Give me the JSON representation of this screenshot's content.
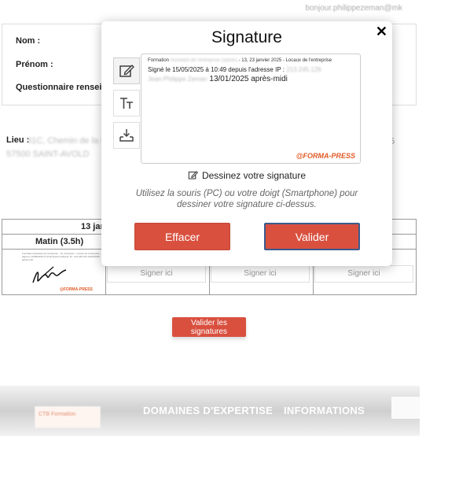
{
  "header": {
    "user_email": "bonjour.philippezeman@mk"
  },
  "info": {
    "nom_label": "Nom :",
    "prenom_label": "Prénom :",
    "questionnaire_label": "Questionnaire renseigné le"
  },
  "location": {
    "label": "Lieu :",
    "value_line1": "31C, Chemin de la Cascade",
    "value_line2": "57500 SAINT-AVOLD",
    "right_fragment": "5"
  },
  "table": {
    "date_header": "13 janv",
    "session_label": "Matin (3.5h)",
    "sign_here": [
      "Signer ici",
      "Signer ici",
      "Signer ici"
    ],
    "small_text": "Formation Assistant de l'entreprise - 13, 23 janvier - Locaux de l'entreprise Signé le 15/05/2025 à 10:49 depuis l'adresse IP : 213.245.126 13/01/2025 après-midi",
    "mini_logo": "@FORMA-PRESS"
  },
  "validate_all_button": "Valider les signatures",
  "footer": {
    "logo_text": "CTB Formation",
    "links": [
      "DOMAINES D'EXPERTISE",
      "INFORMATIONS"
    ]
  },
  "modal": {
    "title": "Signature",
    "close_glyph": "✕",
    "canvas": {
      "line1_prefix": "Formation",
      "line1_blurred": "Assistant de l'entreprise (option)",
      "line1_suffix": "- 13, 23 janvier 2025 - Locaux de l'entreprise",
      "line2_prefix": "Signé le 15/05/2025 à 10:49 depuis l'adresse IP :",
      "line2_blurred": "213.245.126",
      "line3_blurred": "Jean-Philippe Zeman",
      "line3_suffix": "13/01/2025 après-midi",
      "logo": "@FORMA-PRESS"
    },
    "draw_label": "Dessinez votre signature",
    "hint": "Utilisez la souris (PC) ou votre doigt (Smartphone) pour dessiner votre signature ci-dessus.",
    "clear_button": "Effacer",
    "validate_button": "Valider"
  }
}
